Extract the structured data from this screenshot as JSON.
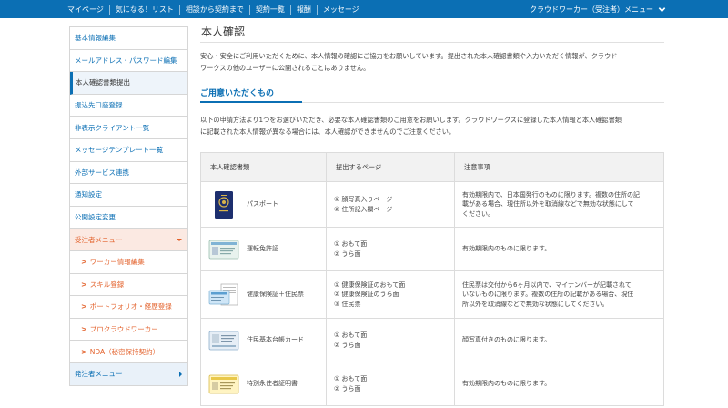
{
  "topnav": {
    "items": [
      "マイページ",
      "気になる！リスト",
      "相談から契約まで",
      "契約一覧",
      "報酬",
      "メッセージ"
    ],
    "user_menu": "クラウドワーカー（受注者）メニュー"
  },
  "sidebar": {
    "items": [
      "基本情報編集",
      "メールアドレス・パスワード編集",
      "本人確認書類提出",
      "振込先口座登録",
      "非表示クライアント一覧",
      "メッセージテンプレート一覧",
      "外部サービス連携",
      "通知設定",
      "公開設定変更"
    ],
    "worker_group": "受注者メニュー",
    "worker_items": [
      "ワーカー情報編集",
      "スキル登録",
      "ポートフォリオ・経歴登録",
      "プロクラウドワーカー",
      "NDA（秘密保持契約）"
    ],
    "client_group": "発注者メニュー"
  },
  "main": {
    "title": "本人確認",
    "intro_1": "安心・安全にご利用いただくために、本人情報の確認にご協力をお願いしています。提出された本人確認書類や入力いただく情報が、クラウド",
    "intro_2": "ワークスの他のユーザーに公開されることはありません。",
    "section_title": "ご用意いただくもの",
    "lead_1": "以下の申請方法より1つをお選びいただき、必要な本人確認書類のご用意をお願いします。クラウドワークスに登録した本人情報と本人確認書類",
    "lead_2": "に記載された本人情報が異なる場合には、本人確認ができませんのでご注意ください。"
  },
  "table": {
    "headers": [
      "本人確認書類",
      "提出するページ",
      "注意事項"
    ],
    "rows": [
      {
        "doc": "パスポート",
        "pages": [
          "① 顔写真入りページ",
          "② 住所記入欄ページ"
        ],
        "notes": [
          "有効期限内で、日本国発行のものに限ります。複数の住所の記",
          "載がある場合、現住所以外を取消線などで無効な状態にして",
          "ください。"
        ]
      },
      {
        "doc": "運転免許証",
        "pages": [
          "① おもて面",
          "② うら面"
        ],
        "notes": [
          "有効期限内のものに限ります。"
        ]
      },
      {
        "doc": "健康保険証＋住民票",
        "pages": [
          "① 健康保険証のおもて面",
          "② 健康保険証のうら面",
          "③ 住民票"
        ],
        "notes": [
          "住民票は交付から6ヶ月以内で、マイナンバーが記載されて",
          "いないものに限ります。複数の住所の記載がある場合、現住",
          "所以外を取消線などで無効な状態にしてください。"
        ]
      },
      {
        "doc": "住民基本台帳カード",
        "pages": [
          "① おもて面",
          "② うら面"
        ],
        "notes": [
          "顔写真付きのものに限ります。"
        ]
      },
      {
        "doc": "特別永住者証明書",
        "pages": [
          "① おもて面",
          "② うら面"
        ],
        "notes": [
          "有効期限内のものに限ります。"
        ]
      }
    ]
  },
  "colors": {
    "primary": "#0b6fb4",
    "accent": "#e3622c"
  }
}
